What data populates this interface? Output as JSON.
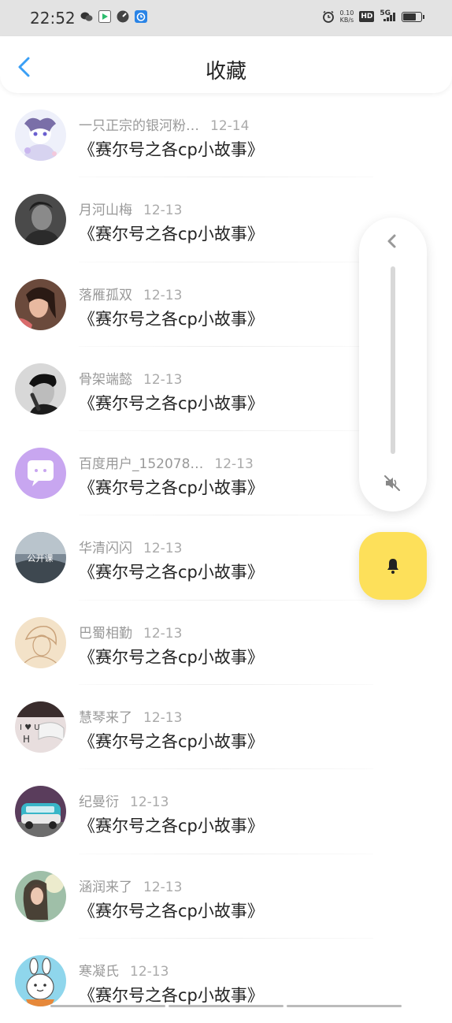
{
  "status_bar": {
    "time": "22:52",
    "net_speed_value": "0.10",
    "net_speed_unit": "KB/s",
    "hd_label": "HD",
    "signal_label": "5G",
    "battery_level": 0.8,
    "app_icons": [
      "wechat-icon",
      "video-app-icon",
      "speedometer-app-icon",
      "alarm-app-icon"
    ]
  },
  "header": {
    "title": "收藏",
    "back_icon": "chevron-left-icon"
  },
  "favorites": [
    {
      "author": "一只正宗的银河粉…",
      "date": "12-14",
      "title": "《赛尔号之各cp小故事》"
    },
    {
      "author": "月河山梅",
      "date": "12-13",
      "title": "《赛尔号之各cp小故事》"
    },
    {
      "author": "落雁孤双",
      "date": "12-13",
      "title": "《赛尔号之各cp小故事》"
    },
    {
      "author": "骨架端懿",
      "date": "12-13",
      "title": "《赛尔号之各cp小故事》"
    },
    {
      "author": "百度用户_152078…",
      "date": "12-13",
      "title": "《赛尔号之各cp小故事》"
    },
    {
      "author": "华清闪闪",
      "date": "12-13",
      "title": "《赛尔号之各cp小故事》"
    },
    {
      "author": "巴蜀相勤",
      "date": "12-13",
      "title": "《赛尔号之各cp小故事》"
    },
    {
      "author": "慧琴来了",
      "date": "12-13",
      "title": "《赛尔号之各cp小故事》"
    },
    {
      "author": "纪曼衍",
      "date": "12-13",
      "title": "《赛尔号之各cp小故事》"
    },
    {
      "author": "涵润来了",
      "date": "12-13",
      "title": "《赛尔号之各cp小故事》"
    },
    {
      "author": "寒凝氏",
      "date": "12-13",
      "title": "《赛尔号之各cp小故事》"
    }
  ],
  "avatar_texts": {
    "huaqing": "公开课",
    "huiqin_top": "I ♥ U",
    "huiqin_bottom": "H"
  },
  "floating_panel": {
    "collapse_icon": "chevron-left-icon",
    "mute_icon": "volume-mute-icon",
    "bell_icon": "bell-icon"
  },
  "colors": {
    "accent_blue": "#3a9ff5",
    "bell_yellow": "#fde05a",
    "meta_gray": "#999999",
    "status_bar_bg": "#e3e3e3"
  }
}
